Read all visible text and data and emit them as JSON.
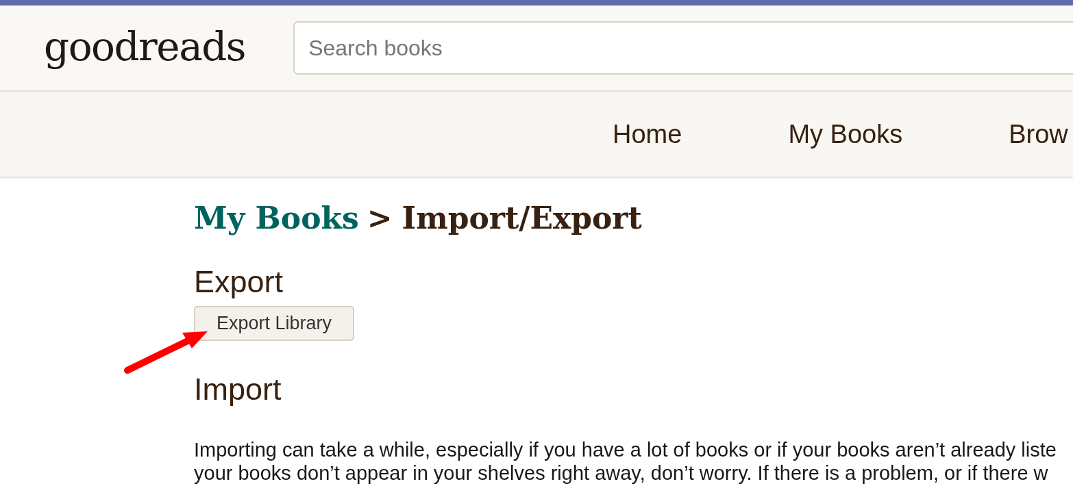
{
  "header": {
    "logo": "goodreads",
    "search": {
      "placeholder": "Search books"
    }
  },
  "nav": {
    "items": [
      {
        "label": "Home"
      },
      {
        "label": "My Books"
      },
      {
        "label": "Brow"
      }
    ]
  },
  "page": {
    "breadcrumb": {
      "link": "My Books",
      "separator": ">",
      "current": "Import/Export"
    },
    "export": {
      "heading": "Export",
      "button": "Export Library"
    },
    "import": {
      "heading": "Import",
      "paragraph_lines": [
        "Importing can take a while, especially if you have a lot of books or if your books aren’t already liste",
        "your books don’t appear in your shelves right away, don’t worry. If there is a problem, or if there w"
      ]
    }
  },
  "annotation": {
    "kind": "arrow"
  }
}
